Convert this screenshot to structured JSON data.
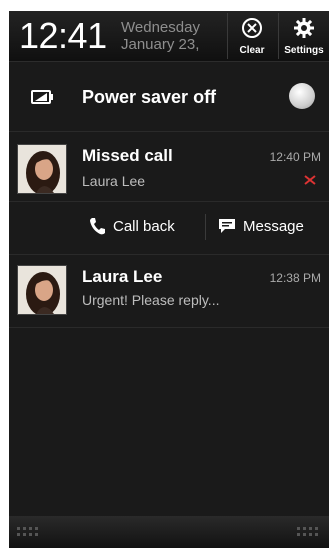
{
  "status": {
    "time": "12:41",
    "day": "Wednesday",
    "date": "January 23,"
  },
  "header_actions": {
    "clear_label": "Clear",
    "settings_label": "Settings"
  },
  "power_saver": {
    "label": "Power saver off",
    "enabled": false
  },
  "notifications": {
    "missed_call": {
      "title": "Missed call",
      "subtitle": "Laura Lee",
      "time": "12:40 PM",
      "actions": {
        "call_back": "Call back",
        "message": "Message"
      }
    },
    "message": {
      "title": "Laura Lee",
      "preview": "Urgent! Please reply...",
      "time": "12:38 PM"
    }
  }
}
